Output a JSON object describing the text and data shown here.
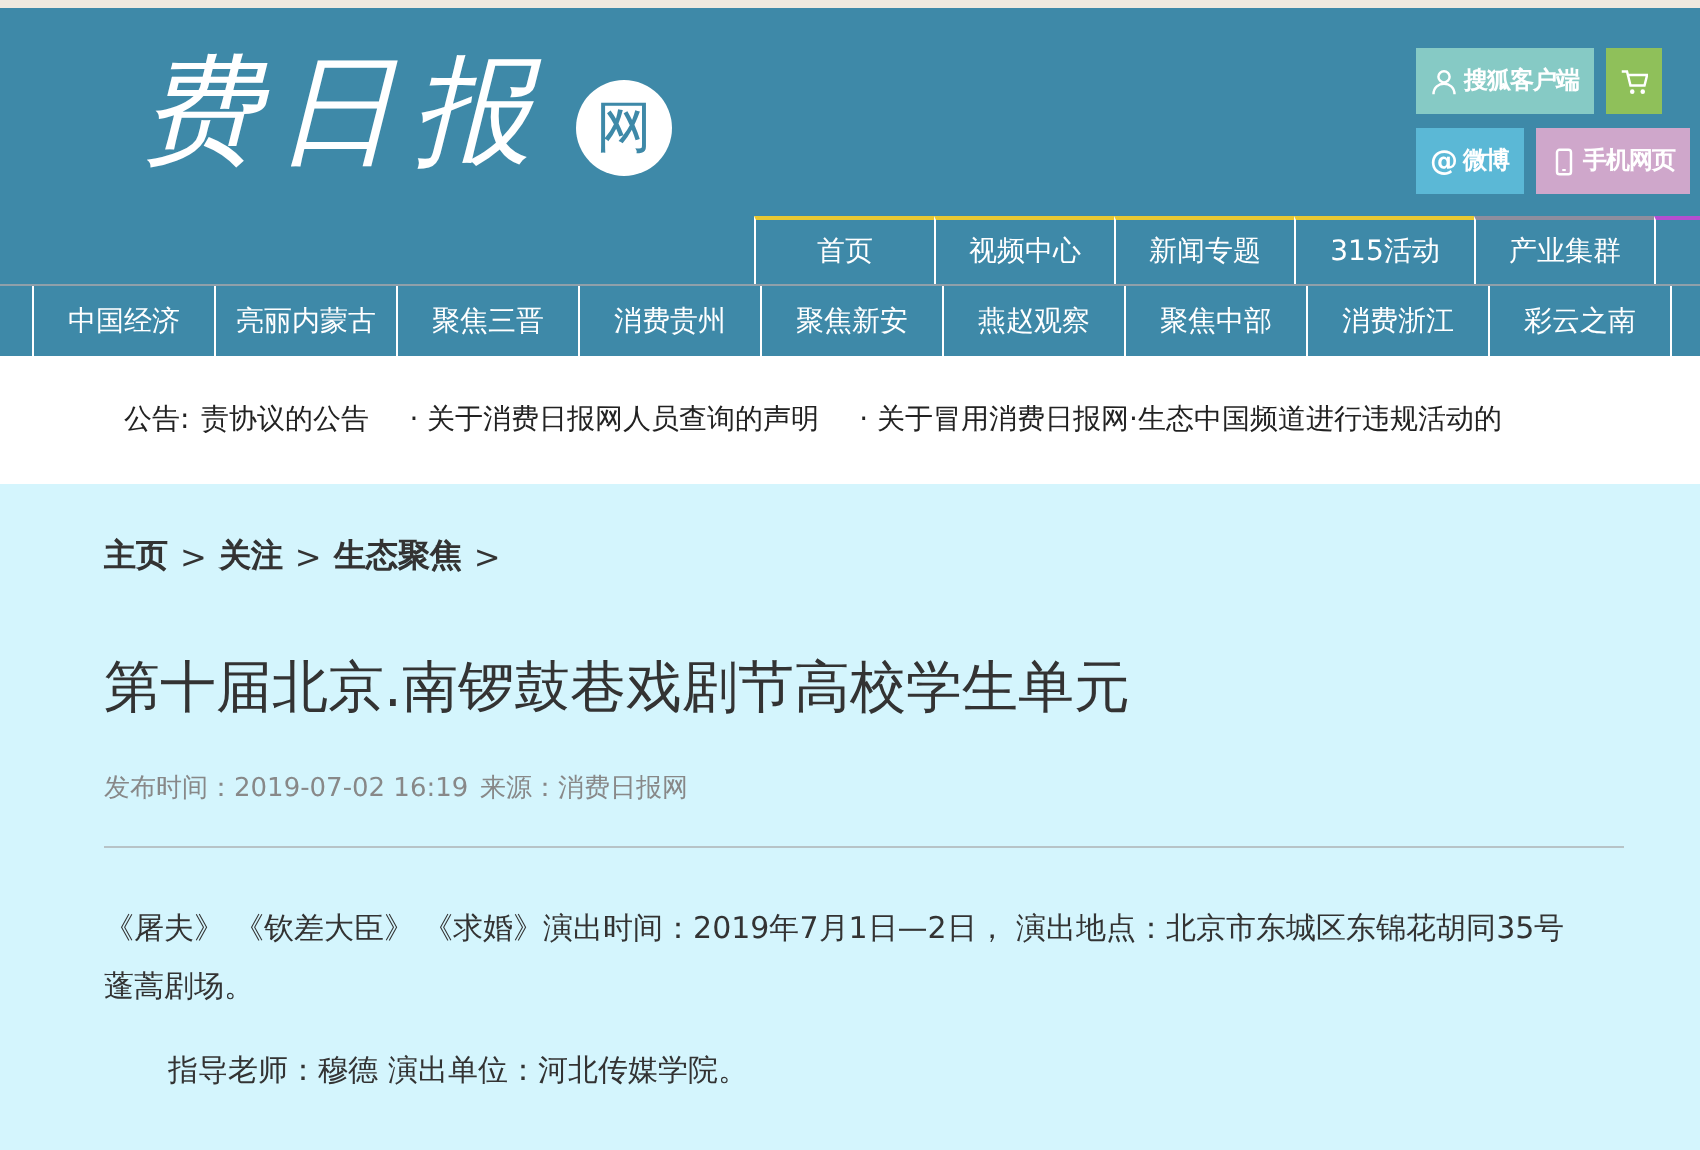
{
  "logo": {
    "text": "费日报",
    "badge": "网"
  },
  "top_links": [
    [
      {
        "kind": "person",
        "label": "搜狐客户端",
        "color": "#86cac5"
      },
      {
        "kind": "cart",
        "color": "#8fc05a"
      }
    ],
    [
      {
        "kind": "glyph",
        "glyph": "@",
        "label": "微博",
        "color": "#5bb8d6"
      },
      {
        "kind": "phone",
        "label": "手机网页",
        "color": "#cfa7cb"
      }
    ]
  ],
  "nav_primary": [
    {
      "label": "首页",
      "color": "#e8c832"
    },
    {
      "label": "视频中心",
      "color": "#e8c832"
    },
    {
      "label": "新闻专题",
      "color": "#e8c832"
    },
    {
      "label": "315活动",
      "color": "#e8c832"
    },
    {
      "label": "产业集群",
      "color": "#8e8e9e"
    },
    {
      "color": "#b44fd0"
    }
  ],
  "nav_secondary": [
    "中国经济",
    "亮丽内蒙古",
    "聚焦三晋",
    "消费贵州",
    "聚焦新安",
    "燕赵观察",
    "聚焦中部",
    "消费浙江",
    "彩云之南"
  ],
  "notice": {
    "label": "公告:",
    "items": [
      "责协议的公告",
      "· 关于消费日报网人员查询的声明",
      "· 关于冒用消费日报网·生态中国频道进行违规活动的"
    ]
  },
  "breadcrumb": {
    "items": [
      "主页",
      "关注",
      "生态聚焦"
    ],
    "separator": ">"
  },
  "article": {
    "title": "第十届北京.南锣鼓巷戏剧节高校学生单元",
    "published": "发布时间：2019-07-02 16:19",
    "source": "来源：消费日报网",
    "paragraphs": [
      {
        "text": "《屠夫》 《钦差大臣》 《求婚》演出时间：2019年7月1日—2日， 演出地点：北京市东城区东锦花胡同35号蓬蒿剧场。",
        "indent": false
      },
      {
        "text": "指导老师：穆德 演出单位：河北传媒学院。",
        "indent": true
      }
    ]
  }
}
